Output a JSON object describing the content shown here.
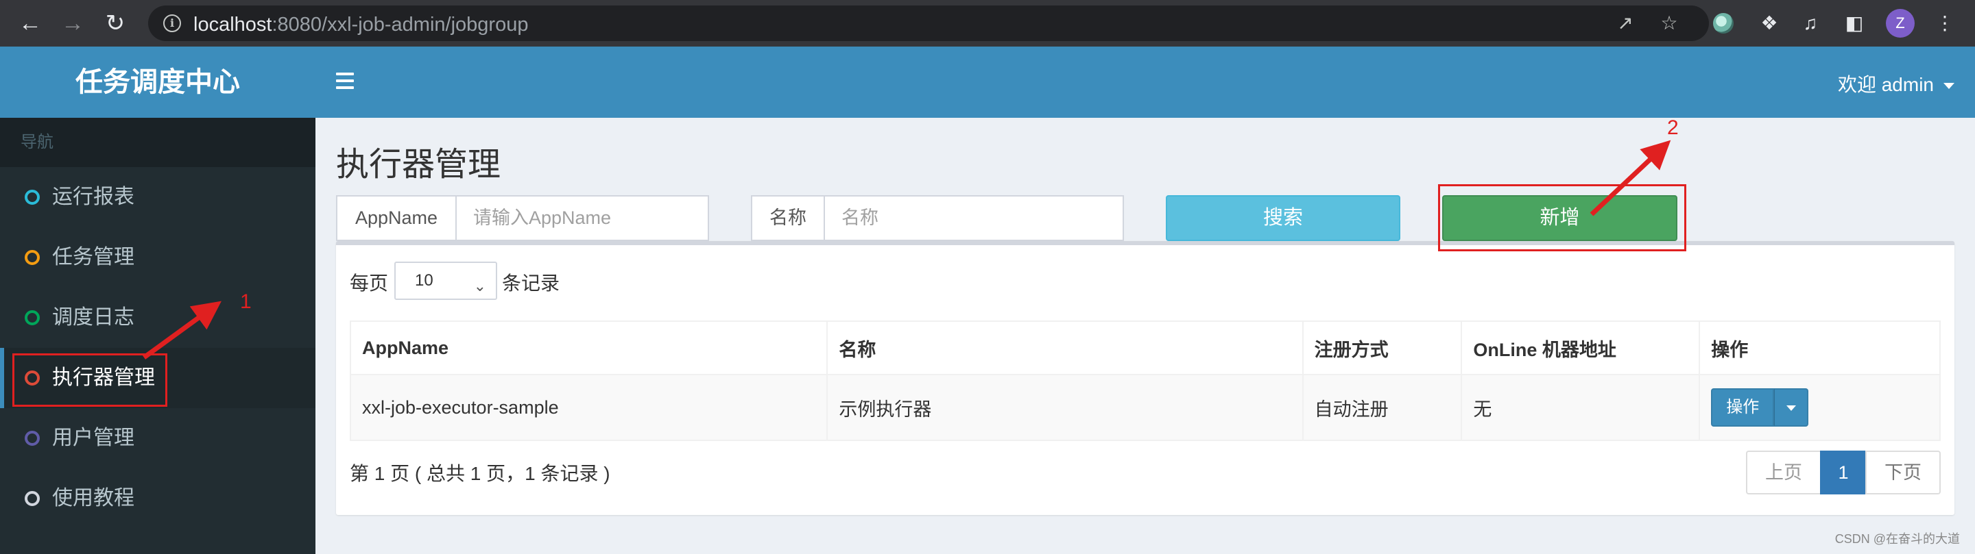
{
  "browser": {
    "url_host": "localhost",
    "url_rest": ":8080/xxl-job-admin/jobgroup",
    "profile_initial": "Z"
  },
  "app": {
    "logo_title": "任务调度中心",
    "user_greeting": "欢迎 admin"
  },
  "sidebar": {
    "header": "导航",
    "items": [
      {
        "label": "运行报表",
        "color": "#2bbbd8"
      },
      {
        "label": "任务管理",
        "color": "#f39c12"
      },
      {
        "label": "调度日志",
        "color": "#00a65a"
      },
      {
        "label": "执行器管理",
        "color": "#dd4b39"
      },
      {
        "label": "用户管理",
        "color": "#605ca8"
      },
      {
        "label": "使用教程",
        "color": "#d2d6de"
      }
    ]
  },
  "page": {
    "title": "执行器管理",
    "filter_appname_label": "AppName",
    "filter_appname_placeholder": "请输入AppName",
    "filter_name_label": "名称",
    "filter_name_placeholder": "名称",
    "search_button": "搜索",
    "add_button": "新增",
    "length_prefix": "每页",
    "length_value": "10",
    "length_suffix": "条记录"
  },
  "table": {
    "headers": [
      "AppName",
      "名称",
      "注册方式",
      "OnLine 机器地址",
      "操作"
    ],
    "rows": [
      {
        "appname": "xxl-job-executor-sample",
        "name": "示例执行器",
        "reg_type": "自动注册",
        "online": "无",
        "op_label": "操作"
      }
    ]
  },
  "pagination": {
    "info": "第 1 页 ( 总共 1 页，1 条记录 )",
    "prev": "上页",
    "current": "1",
    "next": "下页"
  },
  "annotations": {
    "marker_1": "1",
    "marker_2": "2"
  },
  "watermark": "CSDN @在奋斗的大道"
}
